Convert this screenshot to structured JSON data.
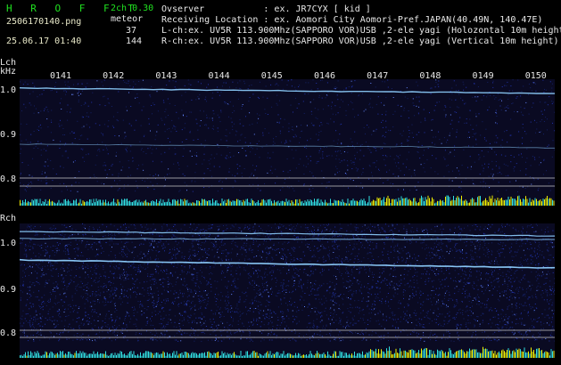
{
  "header": {
    "app_name": "H R O F F T",
    "version": "2ch 0.30",
    "filename": "2506170140.png",
    "meteor_label": "meteor",
    "datetime": "25.06.17 01:40",
    "count_l": "37",
    "count_r": "144",
    "observer": "Ovserver           : ex. JR7CYX [ kid ]",
    "location": "Receiving Location : ex. Aomori City Aomori-Pref.JAPAN(40.49N, 140.47E)",
    "lch_info": "L-ch:ex. UV5R 113.900Mhz(SAPPORO VOR)USB ,2-ele yagi (Holozontal 10m height",
    "rch_info": "R-ch:ex. UV5R 113.900Mhz(SAPPORO VOR)USB ,2-ele yagi (Vertical 10m height)"
  },
  "axes": {
    "lch_label": "Lch",
    "unit_label": "kHz",
    "rch_label": "Rch",
    "time_ticks": [
      "0141",
      "0142",
      "0143",
      "0144",
      "0145",
      "0146",
      "0147",
      "0148",
      "0149",
      "0150"
    ],
    "freq_ticks": [
      "1.0",
      "0.9",
      "0.8"
    ]
  },
  "colors": {
    "background": "#000000",
    "spectrogram_bg": "#0a0a22",
    "noise": "#2233aa",
    "trace": "#8fd0ff",
    "green_text": "#20e020",
    "bar_cyan": "#30e0e0",
    "bar_yellow": "#f0f000"
  }
}
